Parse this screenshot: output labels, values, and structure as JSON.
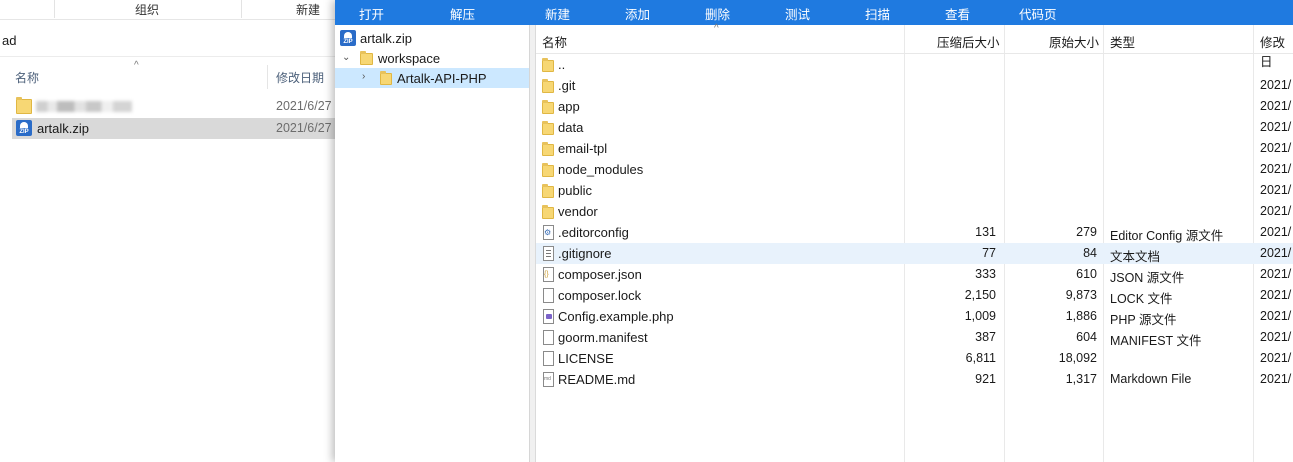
{
  "explorer": {
    "ribbon": {
      "group_label": "组织",
      "new_label": "新建"
    },
    "address": "ad",
    "columns": {
      "name": "名称",
      "date": "修改日期"
    },
    "items": [
      {
        "name": "",
        "date": "2021/6/27",
        "kind": "folder",
        "blurred": true
      },
      {
        "name": "artalk.zip",
        "date": "2021/6/27",
        "kind": "zip",
        "selected": true
      }
    ]
  },
  "zip": {
    "toolbar": [
      "打开",
      "解压",
      "新建",
      "添加",
      "删除",
      "测试",
      "扫描",
      "查看",
      "代码页"
    ],
    "tree": [
      {
        "label": "artalk.zip",
        "icon": "zip-icon"
      },
      {
        "label": "workspace",
        "icon": "folder-icon"
      },
      {
        "label": "Artalk-API-PHP",
        "icon": "folder-icon"
      }
    ],
    "columns": {
      "name": "名称",
      "packed": "压缩后大小",
      "original": "原始大小",
      "type": "类型",
      "modified": "修改日"
    },
    "rows": [
      {
        "name": "..",
        "kind": "folder",
        "packed": "",
        "original": "",
        "type": "",
        "modified": ""
      },
      {
        "name": ".git",
        "kind": "folder",
        "packed": "",
        "original": "",
        "type": "",
        "modified": "2021/"
      },
      {
        "name": "app",
        "kind": "folder",
        "packed": "",
        "original": "",
        "type": "",
        "modified": "2021/"
      },
      {
        "name": "data",
        "kind": "folder",
        "packed": "",
        "original": "",
        "type": "",
        "modified": "2021/"
      },
      {
        "name": "email-tpl",
        "kind": "folder",
        "packed": "",
        "original": "",
        "type": "",
        "modified": "2021/"
      },
      {
        "name": "node_modules",
        "kind": "folder",
        "packed": "",
        "original": "",
        "type": "",
        "modified": "2021/"
      },
      {
        "name": "public",
        "kind": "folder",
        "packed": "",
        "original": "",
        "type": "",
        "modified": "2021/"
      },
      {
        "name": "vendor",
        "kind": "folder",
        "packed": "",
        "original": "",
        "type": "",
        "modified": "2021/"
      },
      {
        "name": ".editorconfig",
        "kind": "cfg",
        "packed": "131",
        "original": "279",
        "type": "Editor Config 源文件",
        "modified": "2021/"
      },
      {
        "name": ".gitignore",
        "kind": "text",
        "packed": "77",
        "original": "84",
        "type": "文本文档",
        "modified": "2021/",
        "highlight": true
      },
      {
        "name": "composer.json",
        "kind": "json",
        "packed": "333",
        "original": "610",
        "type": "JSON 源文件",
        "modified": "2021/"
      },
      {
        "name": "composer.lock",
        "kind": "blank",
        "packed": "2,150",
        "original": "9,873",
        "type": "LOCK 文件",
        "modified": "2021/"
      },
      {
        "name": "Config.example.php",
        "kind": "php",
        "packed": "1,009",
        "original": "1,886",
        "type": "PHP 源文件",
        "modified": "2021/"
      },
      {
        "name": "goorm.manifest",
        "kind": "blank",
        "packed": "387",
        "original": "604",
        "type": "MANIFEST 文件",
        "modified": "2021/"
      },
      {
        "name": "LICENSE",
        "kind": "blank",
        "packed": "6,811",
        "original": "18,092",
        "type": "",
        "modified": "2021/"
      },
      {
        "name": "README.md",
        "kind": "md",
        "packed": "921",
        "original": "1,317",
        "type": "Markdown File",
        "modified": "2021/"
      }
    ]
  },
  "colors": {
    "toolbar": "#1f7ae0",
    "selection": "#cce8ff",
    "folder": "#f7d774"
  }
}
